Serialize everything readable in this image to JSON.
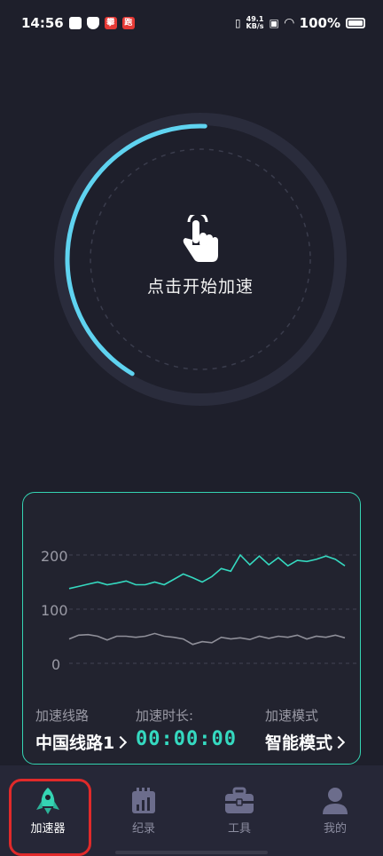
{
  "status_bar": {
    "time": "14:56",
    "net_speed_top": "49.1",
    "net_speed_unit": "KB/s",
    "battery": "100%",
    "red_badge_1": "攀",
    "red_badge_2": "跑"
  },
  "dial": {
    "label": "点击开始加速",
    "progress": 0.42,
    "colors": {
      "arc": "#5fd3f0",
      "track": "#2a2c3c",
      "dash": "#3a3c4c"
    }
  },
  "stats": {
    "y_ticks": [
      "200",
      "100",
      "0"
    ],
    "route_label": "加速线路",
    "route_value": "中国线路1",
    "duration_label": "加速时长:",
    "duration_value": "00:00:00",
    "mode_label": "加速模式",
    "mode_value": "智能模式"
  },
  "chart_data": {
    "type": "line",
    "ylim": [
      0,
      200
    ],
    "grid": true,
    "series": [
      {
        "color": "#35d9c0",
        "values": [
          138,
          142,
          146,
          150,
          145,
          148,
          152,
          145,
          145,
          150,
          145,
          155,
          165,
          158,
          150,
          160,
          175,
          170,
          200,
          182,
          198,
          182,
          195,
          180,
          190,
          188,
          192,
          198,
          192,
          180
        ]
      },
      {
        "color": "#8f8f99",
        "values": [
          45,
          52,
          53,
          50,
          43,
          50,
          50,
          48,
          50,
          55,
          50,
          48,
          45,
          35,
          40,
          38,
          48,
          45,
          47,
          44,
          50,
          46,
          50,
          48,
          52,
          45,
          50,
          48,
          52,
          47
        ]
      }
    ]
  },
  "nav": {
    "items": [
      {
        "label": "加速器",
        "icon": "rocket-icon",
        "active": true
      },
      {
        "label": "纪录",
        "icon": "calendar-chart-icon",
        "active": false
      },
      {
        "label": "工具",
        "icon": "toolbox-icon",
        "active": false
      },
      {
        "label": "我的",
        "icon": "person-icon",
        "active": false
      }
    ],
    "active_color": "#35d4b3"
  }
}
